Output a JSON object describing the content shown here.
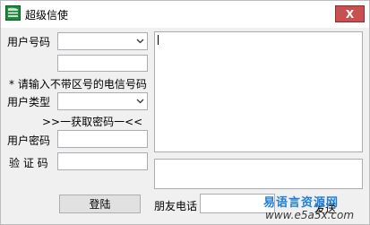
{
  "window": {
    "title": "超级信使",
    "close_label": "X"
  },
  "form": {
    "user_number_label": "用户号码",
    "hint_label": "* 请输入不带区号的电信号码",
    "user_type_label": "用户类型",
    "get_password_link": ">>一获取密码一<<",
    "user_password_label": "用户密码",
    "captcha_label": "验 证 码",
    "login_button": "登陆",
    "friend_phone_label": "朋友电话",
    "send_button": "发送"
  },
  "watermark": {
    "line1": "易语言资源网",
    "line2": "www.e5a5x.com"
  },
  "icons": [
    "app-logo-icon",
    "dropdown-arrow-icon"
  ]
}
